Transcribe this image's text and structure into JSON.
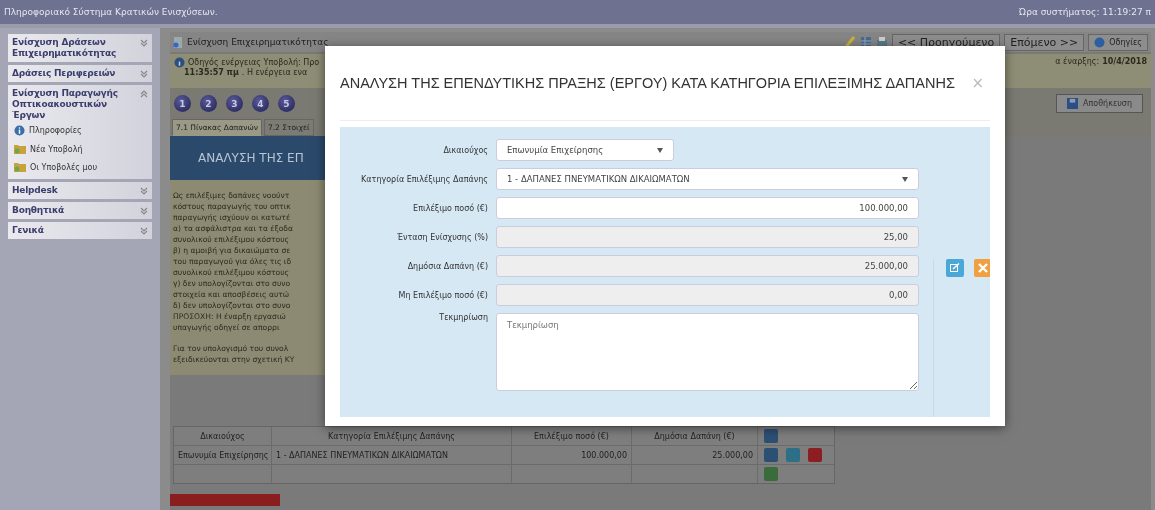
{
  "top_bar": {
    "title": "Πληροφοριακό Σύστημα Κρατικών Ενισχύσεων.",
    "clock": "Ώρα συστήματος: 11:19:27 π"
  },
  "sidebar": {
    "sections": [
      {
        "title": "Ενίσχυση Δράσεων Επιχειρηματικότητας",
        "expanded": false
      },
      {
        "title": "Δράσεις Περιφερειών",
        "expanded": false
      },
      {
        "title": "Ενίσχυση Παραγωγής Οπτικοακουστικών Έργων",
        "expanded": true,
        "items": [
          {
            "label": "Πληροφορίες",
            "kind": "info"
          },
          {
            "label": "Νέα Υποβολή",
            "kind": "folder"
          },
          {
            "label": "Οι Υποβολές μου",
            "kind": "folder"
          }
        ]
      },
      {
        "title": "Helpdesk",
        "expanded": false
      },
      {
        "title": "Βοηθητικά",
        "expanded": false
      },
      {
        "title": "Γενικά",
        "expanded": false
      }
    ]
  },
  "panel": {
    "title": "Ενίσχυση Επιχειρηματικότητας",
    "prev_button": "<< Προηγούμενο",
    "next_button": "Επόμενο >>",
    "help_button": "Οδηγίες",
    "info_line_1": "Οδηγός ενέργειας Υποβολή: Προ",
    "info_time": "11:35:57 πμ",
    "info_line_2": ". Η ενέργεια ενα",
    "start_label": "α έναρξης:",
    "start_date": "10/4/2018",
    "save_button": "Αποθήκευση",
    "steps": [
      "1",
      "2",
      "3",
      "4",
      "5"
    ],
    "tabs": [
      {
        "label": "7.1 Πίνακας Δαπανών",
        "selected": true
      },
      {
        "label": "7.2 Στοιχεί",
        "selected": false
      }
    ],
    "banner": "ΑΝΑΛΥΣΗ ΤΗΣ ΕΠ",
    "paragraph_lines": [
      "Ως επιλέξιμες δαπάνες νοούντ",
      "κόστους παραγωγής του οπτικ",
      "παραγωγής ισχύουν οι κατωτέ",
      "α) τα ασφάλιστρα και τα έξοδα",
      "συνολικού επιλέξιμου κόστους",
      "β) η αμοιβή για δικαιώματα σε",
      "του παραγωγού για όλες τις ιδ",
      "συνολικού επιλέξιμου κόστους",
      "γ) δεν υπολογίζονται στο συνο",
      "στοιχεία και αποσβέσεις αυτώ",
      "δ) δεν υπολογίζονται στο συνο",
      "ΠΡΟΣΟΧΗ: Η έναρξη εργασιώ",
      "υπαγωγής οδηγεί σε απορρι"
    ],
    "paragraph_lines_2": [
      "Για τον υπολογισμό του συνολ",
      "εξειδικεύονται στην σχετική ΚΥ"
    ],
    "table": {
      "columns": [
        "Δικαιούχος",
        "Κατηγορία Επιλέξιμης Δαπάνης",
        "Επιλέξιμο ποσό (€)",
        "Δημόσια Δαπάνη (€)"
      ],
      "rows": [
        [
          "Επωνυμία Επιχείρησης",
          "1 - ΔΑΠΑΝΕΣ ΠΝΕΥΜΑΤΙΚΩΝ ΔΙΚΑΙΩΜΑΤΩΝ",
          "100.000,00",
          "25.000,00"
        ]
      ]
    }
  },
  "modal": {
    "title": "ΑΝΑΛΥΣΗ ΤΗΣ ΕΠΕΝΔΥΤΙΚΗΣ ΠΡΑΞΗΣ (ΕΡΓΟΥ) ΚΑΤΑ ΚΑΤΗΓΟΡΙΑ ΕΠΙΛΕΞΙΜΗΣ ΔΑΠΑΝΗΣ",
    "close": "×",
    "fields": [
      {
        "label": "Δικαιούχος",
        "kind": "select",
        "value": "Επωνυμία Επιχείρησης",
        "wide": false
      },
      {
        "label": "Κατηγορία Επιλέξιμης Δαπάνης",
        "kind": "select",
        "value": "1 - ΔΑΠΑΝΕΣ ΠΝΕΥΜΑΤΙΚΩΝ ΔΙΚΑΙΩΜΑΤΩΝ",
        "wide": true
      },
      {
        "label": "Επιλέξιμο ποσό (€)",
        "kind": "input",
        "value": "100.000,00"
      },
      {
        "label": "Ένταση Ενίσχυσης (%)",
        "kind": "readonly",
        "value": "25,00"
      },
      {
        "label": "Δημόσια Δαπάνη (€)",
        "kind": "readonly",
        "value": "25.000,00"
      },
      {
        "label": "Μη Επιλέξιμο ποσό (€)",
        "kind": "readonly",
        "value": "0,00"
      },
      {
        "label": "Τεκμηρίωση",
        "kind": "textarea",
        "placeholder": "Τεκμηρίωση"
      }
    ]
  }
}
